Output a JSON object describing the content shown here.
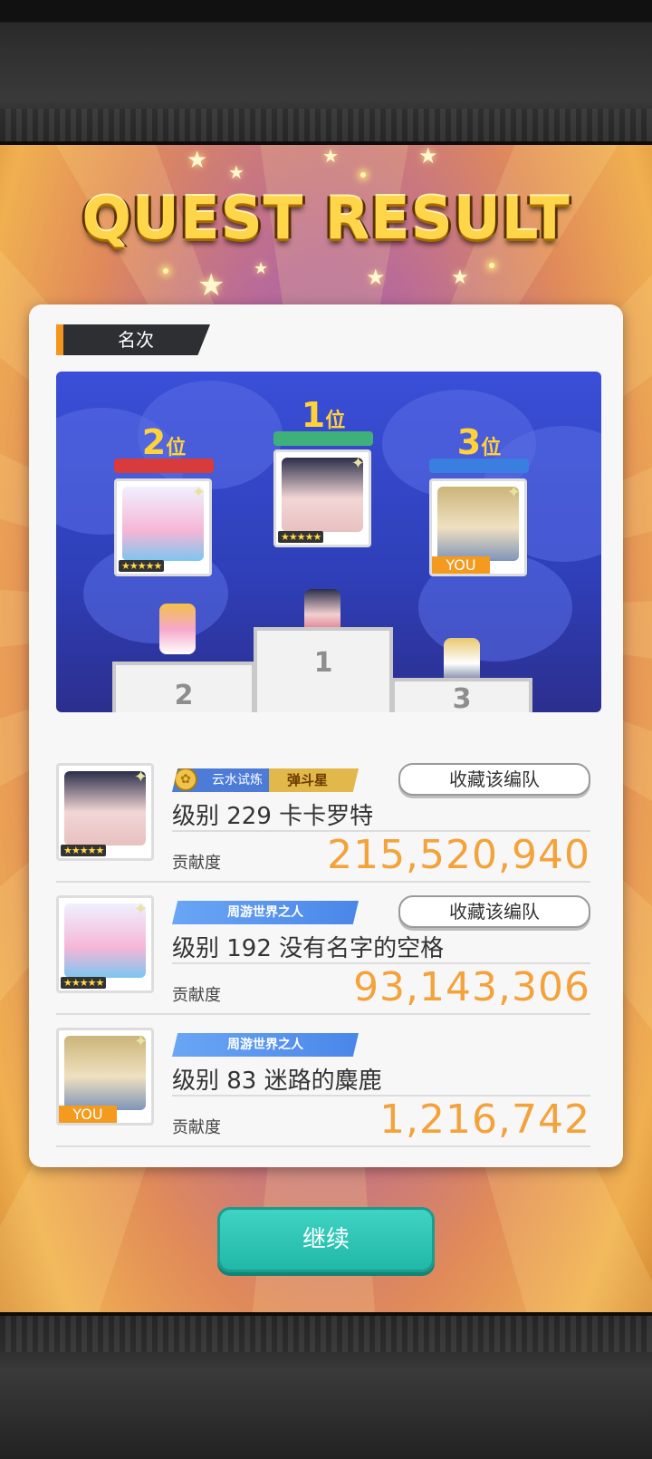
{
  "header": {
    "title": "QUEST RESULT"
  },
  "ranking_section": {
    "tab_label": "名次"
  },
  "podium": {
    "first": {
      "rank": "1",
      "suffix": "位",
      "stars": "★★★★★",
      "stand_number": "1"
    },
    "second": {
      "rank": "2",
      "suffix": "位",
      "stars": "★★★★★",
      "stand_number": "2"
    },
    "third": {
      "rank": "3",
      "suffix": "位",
      "badge": "YOU",
      "stand_number": "3"
    }
  },
  "players": [
    {
      "title_left": "云水试炼",
      "title_right": "弹斗星",
      "save_label": "收藏该编队",
      "name": "级别 229 卡卡罗特",
      "contribution_label": "贡献度",
      "score": "215,520,940",
      "stars": "★★★★★"
    },
    {
      "title": "周游世界之人",
      "save_label": "收藏该编队",
      "name": "级别 192 没有名字的空格",
      "contribution_label": "贡献度",
      "score": "93,143,306",
      "stars": "★★★★★"
    },
    {
      "title": "周游世界之人",
      "name": "级别 83 迷路的麋鹿",
      "contribution_label": "贡献度",
      "score": "1,216,742",
      "badge": "YOU"
    }
  ],
  "continue_label": "继续",
  "colors": {
    "accent_orange": "#f4a23a",
    "continue_teal": "#2ec4b2",
    "rank1_ribbon": "#3fb07a",
    "rank2_ribbon": "#d93a3a",
    "rank3_ribbon": "#3a7fe0"
  },
  "icons": [
    "star-icon",
    "sparkle-icon",
    "title-emblem-icon"
  ]
}
